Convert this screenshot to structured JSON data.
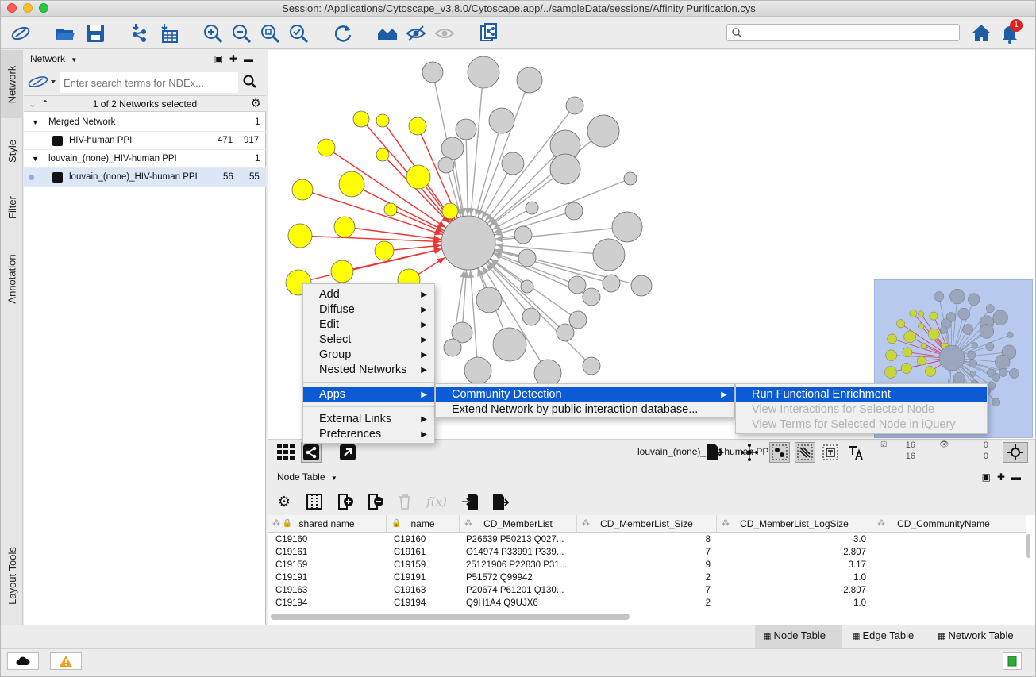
{
  "window": {
    "title": "Session: /Applications/Cytoscape_v3.8.0/Cytoscape.app/../sampleData/sessions/Affinity Purification.cys"
  },
  "toolbar": {
    "search_placeholder": "",
    "notification_count": "1"
  },
  "side_tabs": [
    "Network",
    "Style",
    "Filter",
    "Annotation",
    "Layout Tools"
  ],
  "network_panel": {
    "title": "Network",
    "ndex_placeholder": "Enter search terms for NDEx...",
    "selection_status": "1 of 2 Networks selected",
    "tree": [
      {
        "label": "Merged Network",
        "count": "1"
      },
      {
        "label": "HIV-human PPI",
        "nodes": "471",
        "edges": "917"
      },
      {
        "label": "louvain_(none)_HIV-human PPI",
        "count": "1"
      },
      {
        "label": "louvain_(none)_HIV-human PPI",
        "nodes": "56",
        "edges": "55"
      }
    ]
  },
  "network_view": {
    "network_name": "louvain_(none)_HIV-human PPI",
    "sel_nodes": "16",
    "sel_edges": "16",
    "hidden_nodes": "0",
    "hidden_edges": "0"
  },
  "context_menu": {
    "main": [
      "Add",
      "Diffuse",
      "Edit",
      "Select",
      "Group",
      "Nested Networks",
      "Apps",
      "External Links",
      "Preferences"
    ],
    "apps": [
      "Community Detection",
      "Extend Network by public interaction database..."
    ],
    "community": [
      "Run Functional Enrichment",
      "View Interactions for Selected Node",
      "View Terms for Selected Node in iQuery"
    ]
  },
  "node_table": {
    "title": "Node Table",
    "columns": [
      "shared name",
      "name",
      "CD_MemberList",
      "CD_MemberList_Size",
      "CD_MemberList_LogSize",
      "CD_CommunityName"
    ],
    "rows": [
      [
        "C19160",
        "C19160",
        "P26639 P50213 Q027...",
        "8",
        "3.0",
        ""
      ],
      [
        "C19161",
        "C19161",
        "O14974 P33991 P339...",
        "7",
        "2.807",
        ""
      ],
      [
        "C19159",
        "C19159",
        "25121906 P22830 P31...",
        "9",
        "3.17",
        ""
      ],
      [
        "C19191",
        "C19191",
        "P51572 Q99942",
        "2",
        "1.0",
        ""
      ],
      [
        "C19163",
        "C19163",
        "P20674 P61201 Q130...",
        "7",
        "2.807",
        ""
      ],
      [
        "C19194",
        "C19194",
        "Q9H1A4 Q9UJX6",
        "2",
        "1.0",
        ""
      ]
    ]
  },
  "bottom_tabs": [
    "Node Table",
    "Edge Table",
    "Network Table"
  ],
  "colors": {
    "node_gray": "#cfcfcf",
    "node_yellow": "#ffff00",
    "edge_red": "#ee3333",
    "edge_gray": "#a8a8a8",
    "menu_highlight": "#0b5bd7",
    "minimap_bg": "#b8c9ee"
  }
}
